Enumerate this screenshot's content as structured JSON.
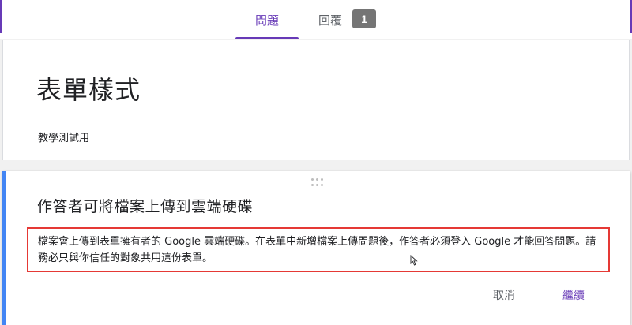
{
  "tabs": {
    "questions_label": "問題",
    "responses_label": "回覆",
    "responses_count": "1"
  },
  "form": {
    "title": "表單樣式",
    "description": "教學測試用"
  },
  "dialog": {
    "title": "作答者可將檔案上傳到雲端硬碟",
    "body": "檔案會上傳到表單擁有者的 Google 雲端硬碟。在表單中新增檔案上傳問題後，作答者必須登入 Google 才能回答問題。請務必只與你信任的對象共用這份表單。",
    "cancel_label": "取消",
    "continue_label": "繼續"
  },
  "colors": {
    "accent": "#673ab7",
    "dialog_accent": "#4285f4",
    "highlight_border": "#e53935"
  }
}
